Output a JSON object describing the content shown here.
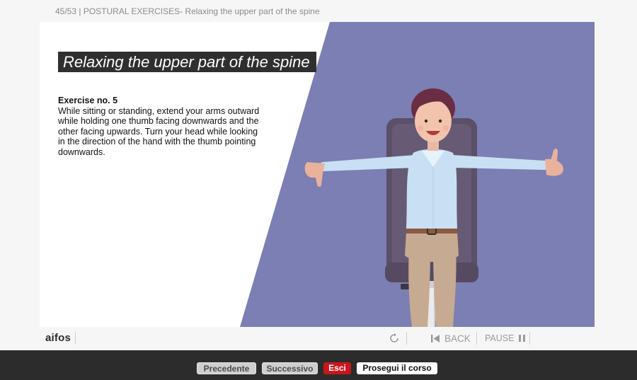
{
  "header": {
    "title": "45/53 | POSTURAL EXERCISES- Relaxing the upper part of the spine"
  },
  "slide": {
    "heading": "Relaxing the upper part of the spine",
    "exercise_title": "Exercise no. 5",
    "exercise_text": "While sitting or standing, extend your arms outward while holding one thumb facing downwards and the other facing upwards. Turn your head while looking in the direction of the hand with the thumb pointing downwards.",
    "accent_color": "#7b7fb3"
  },
  "player": {
    "logo": "aifos",
    "replay_icon": "replay-icon",
    "back_label": "BACK",
    "back_icon": "skip-back-icon",
    "pause_label": "PAUSE",
    "pause_icon": "pause-icon"
  },
  "nav": {
    "prev_label": "Precedente",
    "next_label": "Successivo",
    "exit_label": "Esci",
    "continue_label": "Prosegui il corso",
    "exit_color": "#c8161d"
  }
}
